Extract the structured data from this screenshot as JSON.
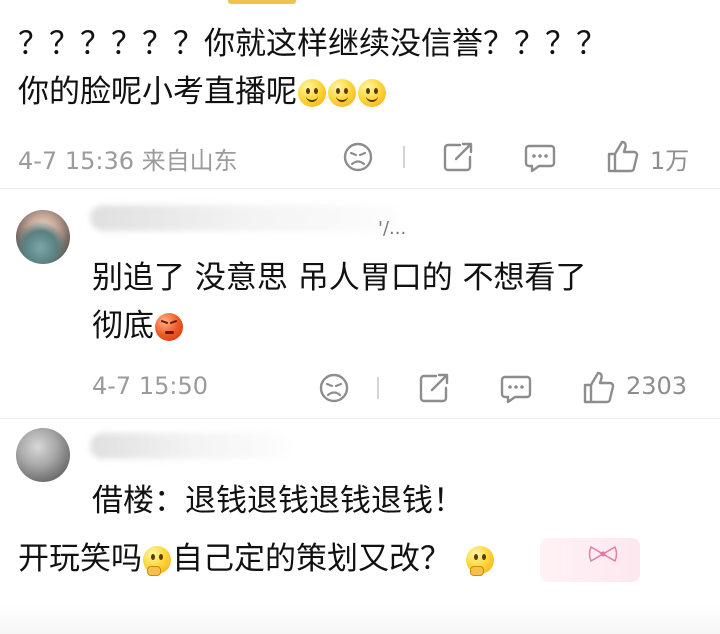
{
  "comment_1": {
    "line_1": "？？？？？？你就这样继续没信誉？？？？",
    "line_2": "你的脸呢小考直播呢",
    "emoji_name": "smile-emoji",
    "time": "4-7 15:36  来自山东",
    "like_count": "1万"
  },
  "comment_2": {
    "username_suffix": "'/...",
    "line_1": "别追了 没意思 吊人胃口的 不想看了",
    "line_2": "彻底",
    "emoji_name": "angry-emoji",
    "time": "4-7 15:50",
    "like_count": "2303"
  },
  "comment_3": {
    "line_1": "借楼：退钱退钱退钱退钱！",
    "line_2_part_1": "开玩笑吗",
    "line_2_part_2": "自己定的策划又改？",
    "emoji_name": "thinking-emoji"
  },
  "colors": {
    "meta_gray": "#9b9b9b",
    "text": "#111111"
  }
}
